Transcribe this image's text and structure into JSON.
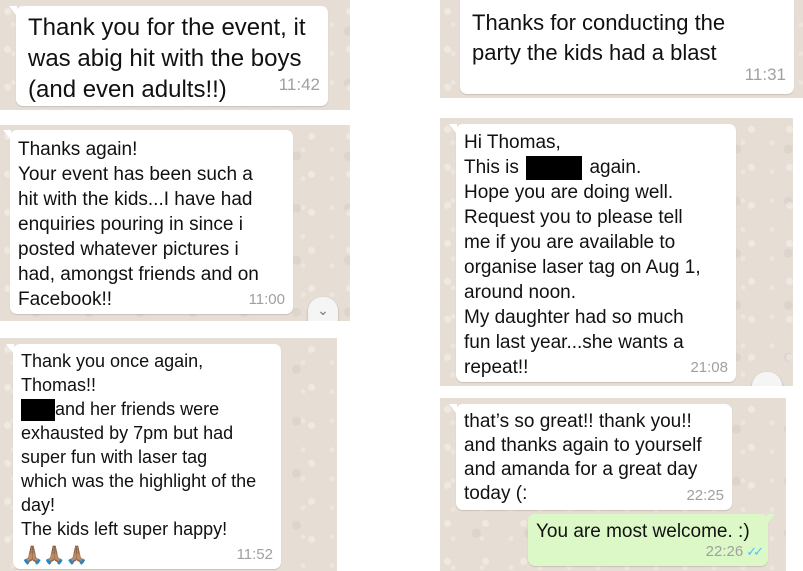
{
  "panel1": {
    "lines": [
      "Thank you for the event, it",
      "was abig hit with the boys",
      "(and even adults!!)"
    ],
    "time": "11:42"
  },
  "panel2": {
    "lines": [
      "Thanks again!",
      "Your event has been such a",
      "hit with the kids...I have had",
      "enquiries pouring in since i",
      "posted whatever pictures i",
      "had, amongst friends and on",
      "Facebook!!"
    ],
    "time": "11:00",
    "scroll_icon": "double-chevron-down-icon",
    "scroll_glyph": "⌄"
  },
  "panel3": {
    "lines": [
      "Thank you once again,",
      "Thomas!!"
    ],
    "line3_rest": "and her friends were",
    "lines_after": [
      "exhausted by 7pm but had",
      "super fun with laser tag",
      "which was the highlight of the",
      "day!",
      "The kids left super happy!"
    ],
    "emoji": "🙏🏽🙏🏽🙏🏽",
    "time": "11:52"
  },
  "panel4": {
    "lines": [
      "Thanks for conducting the",
      "party the kids had a blast"
    ],
    "time": "11:31"
  },
  "panel5": {
    "line1": "Hi Thomas,",
    "line2_pre": "This is",
    "line2_post": "again.",
    "lines_after": [
      "Hope you are doing well.",
      "Request you to please tell",
      "me if you are available to",
      "organise laser tag on Aug 1,",
      "around noon.",
      "My daughter had so much",
      "fun last year...she wants a",
      "repeat!!"
    ],
    "time": "21:08",
    "scroll_glyph": "⌄"
  },
  "panel6": {
    "incoming_lines": [
      "that’s so great!! thank you!!",
      "and thanks again to yourself",
      "and amanda for a great day",
      "today (:"
    ],
    "incoming_time": "22:25",
    "outgoing_text": "You are most welcome. :)",
    "outgoing_time": "22:26",
    "read_ticks": "✓✓",
    "colors": {
      "outgoing_bubble": "#dcf8c6",
      "read_tick": "#4fc3f7"
    }
  }
}
